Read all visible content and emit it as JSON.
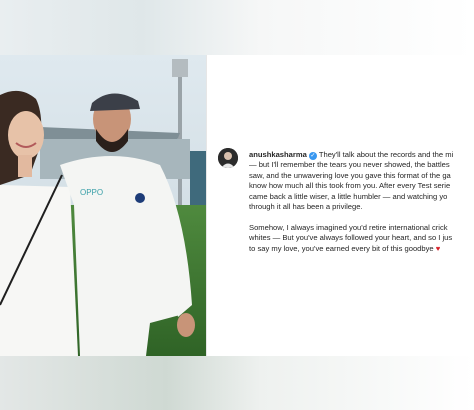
{
  "post": {
    "username": "anushkasharma",
    "para1_line1": "They'll talk about the records and the mi",
    "para1_line2": "— but I'll remember the tears you never showed, the battles",
    "para1_line3": "saw, and the unwavering love you gave this format of the ga",
    "para1_line4": "know how much all this took from you. After every Test serie",
    "para1_line5": "came back a little wiser, a little humbler — and watching yo",
    "para1_line6": "through it all has been a privilege.",
    "para2_line1": "Somehow, I always imagined you'd retire international crick",
    "para2_line2": "whites — But you've always followed your heart, and so I jus",
    "para2_line3": "to say my love, you've earned every bit of this goodbye"
  },
  "icons": {
    "verified": "verified-badge-icon",
    "heart": "red-heart-emoji",
    "avatar": "profile-avatar"
  },
  "colors": {
    "verified": "#3897f0",
    "heart": "#d61f26",
    "text": "#262626"
  }
}
